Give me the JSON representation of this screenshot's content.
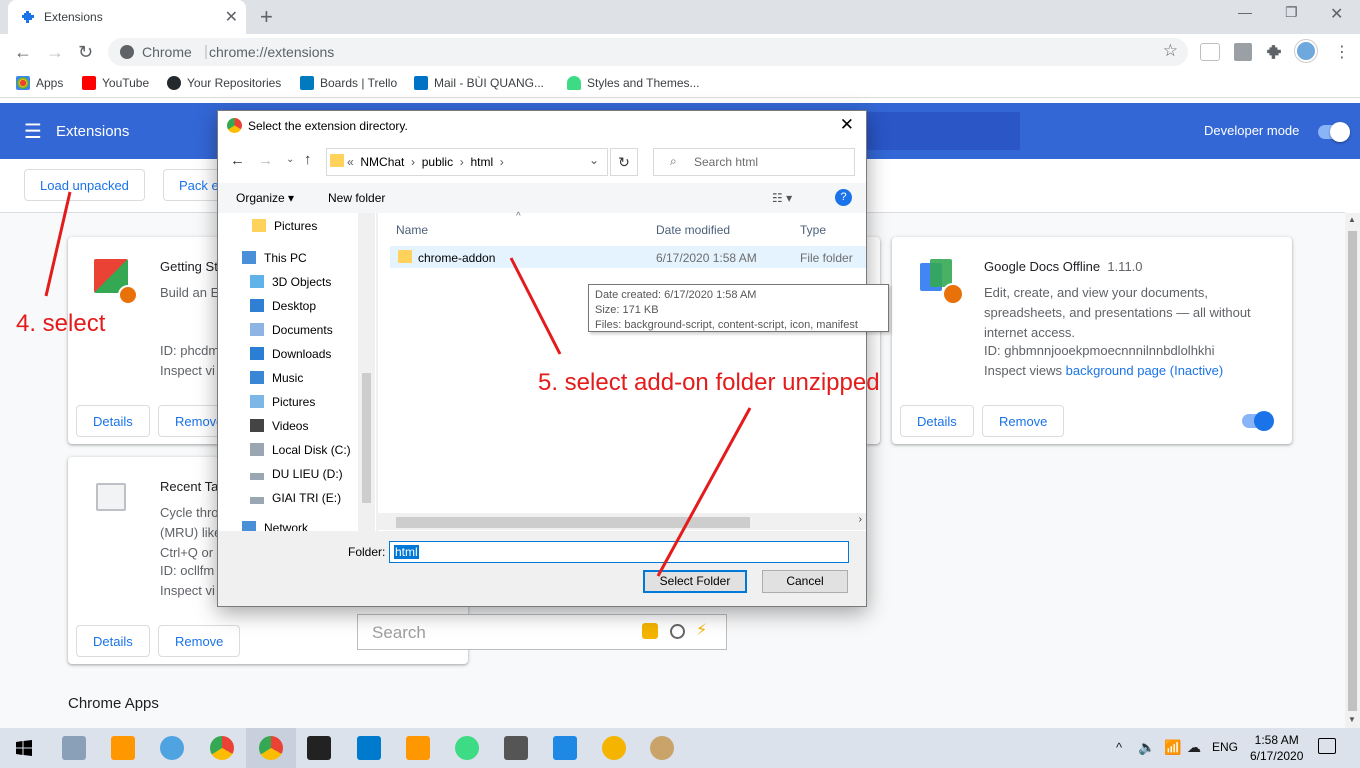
{
  "browser": {
    "tab_title": "Extensions",
    "omnibox_site": "Chrome",
    "omnibox_url": "chrome://extensions",
    "bookmarks": [
      {
        "label": "Apps",
        "icon": "apps-grid-icon",
        "color": "#ea4335"
      },
      {
        "label": "YouTube",
        "icon": "youtube-icon",
        "color": "#ff0000"
      },
      {
        "label": "Your Repositories",
        "icon": "github-icon",
        "color": "#24292e"
      },
      {
        "label": "Boards | Trello",
        "icon": "trello-icon",
        "color": "#0079bf"
      },
      {
        "label": "Mail - BÙI QUANG...",
        "icon": "outlook-icon",
        "color": "#0072c6"
      },
      {
        "label": "Styles and Themes...",
        "icon": "android-icon",
        "color": "#3ddc84"
      }
    ]
  },
  "extensions_page": {
    "header_title": "Extensions",
    "developer_mode_label": "Developer mode",
    "load_unpacked_label": "Load unpacked",
    "pack_label": "Pack e",
    "chrome_apps_label": "Chrome Apps",
    "cards": [
      {
        "name": "Getting St",
        "desc": "Build an E",
        "id": "ID: phcdm",
        "views": "Inspect vi",
        "details": "Details",
        "remove": "Remove"
      },
      {
        "name": "Recent Ta",
        "desc": "Cycle thro\n(MRU) like\nCtrl+Q or C",
        "id": "ID: ocllfm",
        "views": "Inspect vi",
        "details": "Details",
        "remove": "Remove"
      },
      {
        "name": "Google Docs Offline",
        "version": "1.11.0",
        "desc": "Edit, create, and view your documents, spreadsheets, and presentations — all without internet access.",
        "id": "ID: ghbmnnjooekpmoecnnnilnnbdlolhkhi",
        "views_prefix": "Inspect views",
        "views_link": "background page (Inactive)",
        "details": "Details",
        "remove": "Remove"
      }
    ],
    "search_placeholder": "Search"
  },
  "dialog": {
    "title": "Select the extension directory.",
    "path": [
      "NMChat",
      "public",
      "html"
    ],
    "search_placeholder": "Search html",
    "organize_label": "Organize",
    "new_folder_label": "New folder",
    "tree": [
      {
        "label": "Pictures",
        "icon": "folder-icon",
        "indent": 1
      },
      {
        "label": "This PC",
        "icon": "computer-icon",
        "indent": 0
      },
      {
        "label": "3D Objects",
        "icon": "cube-icon",
        "indent": 1
      },
      {
        "label": "Desktop",
        "icon": "desktop-icon",
        "indent": 1
      },
      {
        "label": "Documents",
        "icon": "documents-icon",
        "indent": 1
      },
      {
        "label": "Downloads",
        "icon": "download-icon",
        "indent": 1
      },
      {
        "label": "Music",
        "icon": "music-icon",
        "indent": 1
      },
      {
        "label": "Pictures",
        "icon": "pictures-icon",
        "indent": 1
      },
      {
        "label": "Videos",
        "icon": "videos-icon",
        "indent": 1
      },
      {
        "label": "Local Disk (C:)",
        "icon": "drive-icon",
        "indent": 1,
        "selected": true
      },
      {
        "label": "DU LIEU (D:)",
        "icon": "drive-icon",
        "indent": 1
      },
      {
        "label": "GIAI TRI (E:)",
        "icon": "drive-icon",
        "indent": 1
      },
      {
        "label": "Network",
        "icon": "network-icon",
        "indent": 0
      }
    ],
    "columns": {
      "name": "Name",
      "date": "Date modified",
      "type": "Type"
    },
    "file": {
      "name": "chrome-addon",
      "date": "6/17/2020 1:58 AM",
      "type": "File folder"
    },
    "tooltip": {
      "created": "Date created: 6/17/2020 1:58 AM",
      "size": "Size: 171 KB",
      "files": "Files: background-script, content-script, icon, manifest"
    },
    "folder_label": "Folder:",
    "folder_value": "html",
    "select_button": "Select Folder",
    "cancel_button": "Cancel"
  },
  "annotations": {
    "step4": "4. select",
    "step5": "5. select add-on folder unzipped"
  },
  "taskbar": {
    "lang": "ENG",
    "time": "1:58 AM",
    "date": "6/17/2020"
  }
}
